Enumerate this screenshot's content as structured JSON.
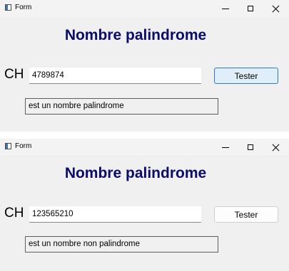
{
  "windows": [
    {
      "title": "Form",
      "heading": "Nombre palindrome",
      "field_label": "CH",
      "input_value": "4789874",
      "button_label": "Tester",
      "result_text": "est un nombre palindrome"
    },
    {
      "title": "Form",
      "heading": "Nombre palindrome",
      "field_label": "CH",
      "input_value": "123565210",
      "button_label": "Tester",
      "result_text": "est un nombre non palindrome"
    }
  ],
  "colors": {
    "heading": "#0b0b6b",
    "window_background": "#f0f0f0",
    "focused_button_border": "#2a7ad6"
  },
  "icons": [
    "app-icon",
    "minimize-icon",
    "maximize-icon",
    "close-icon"
  ]
}
